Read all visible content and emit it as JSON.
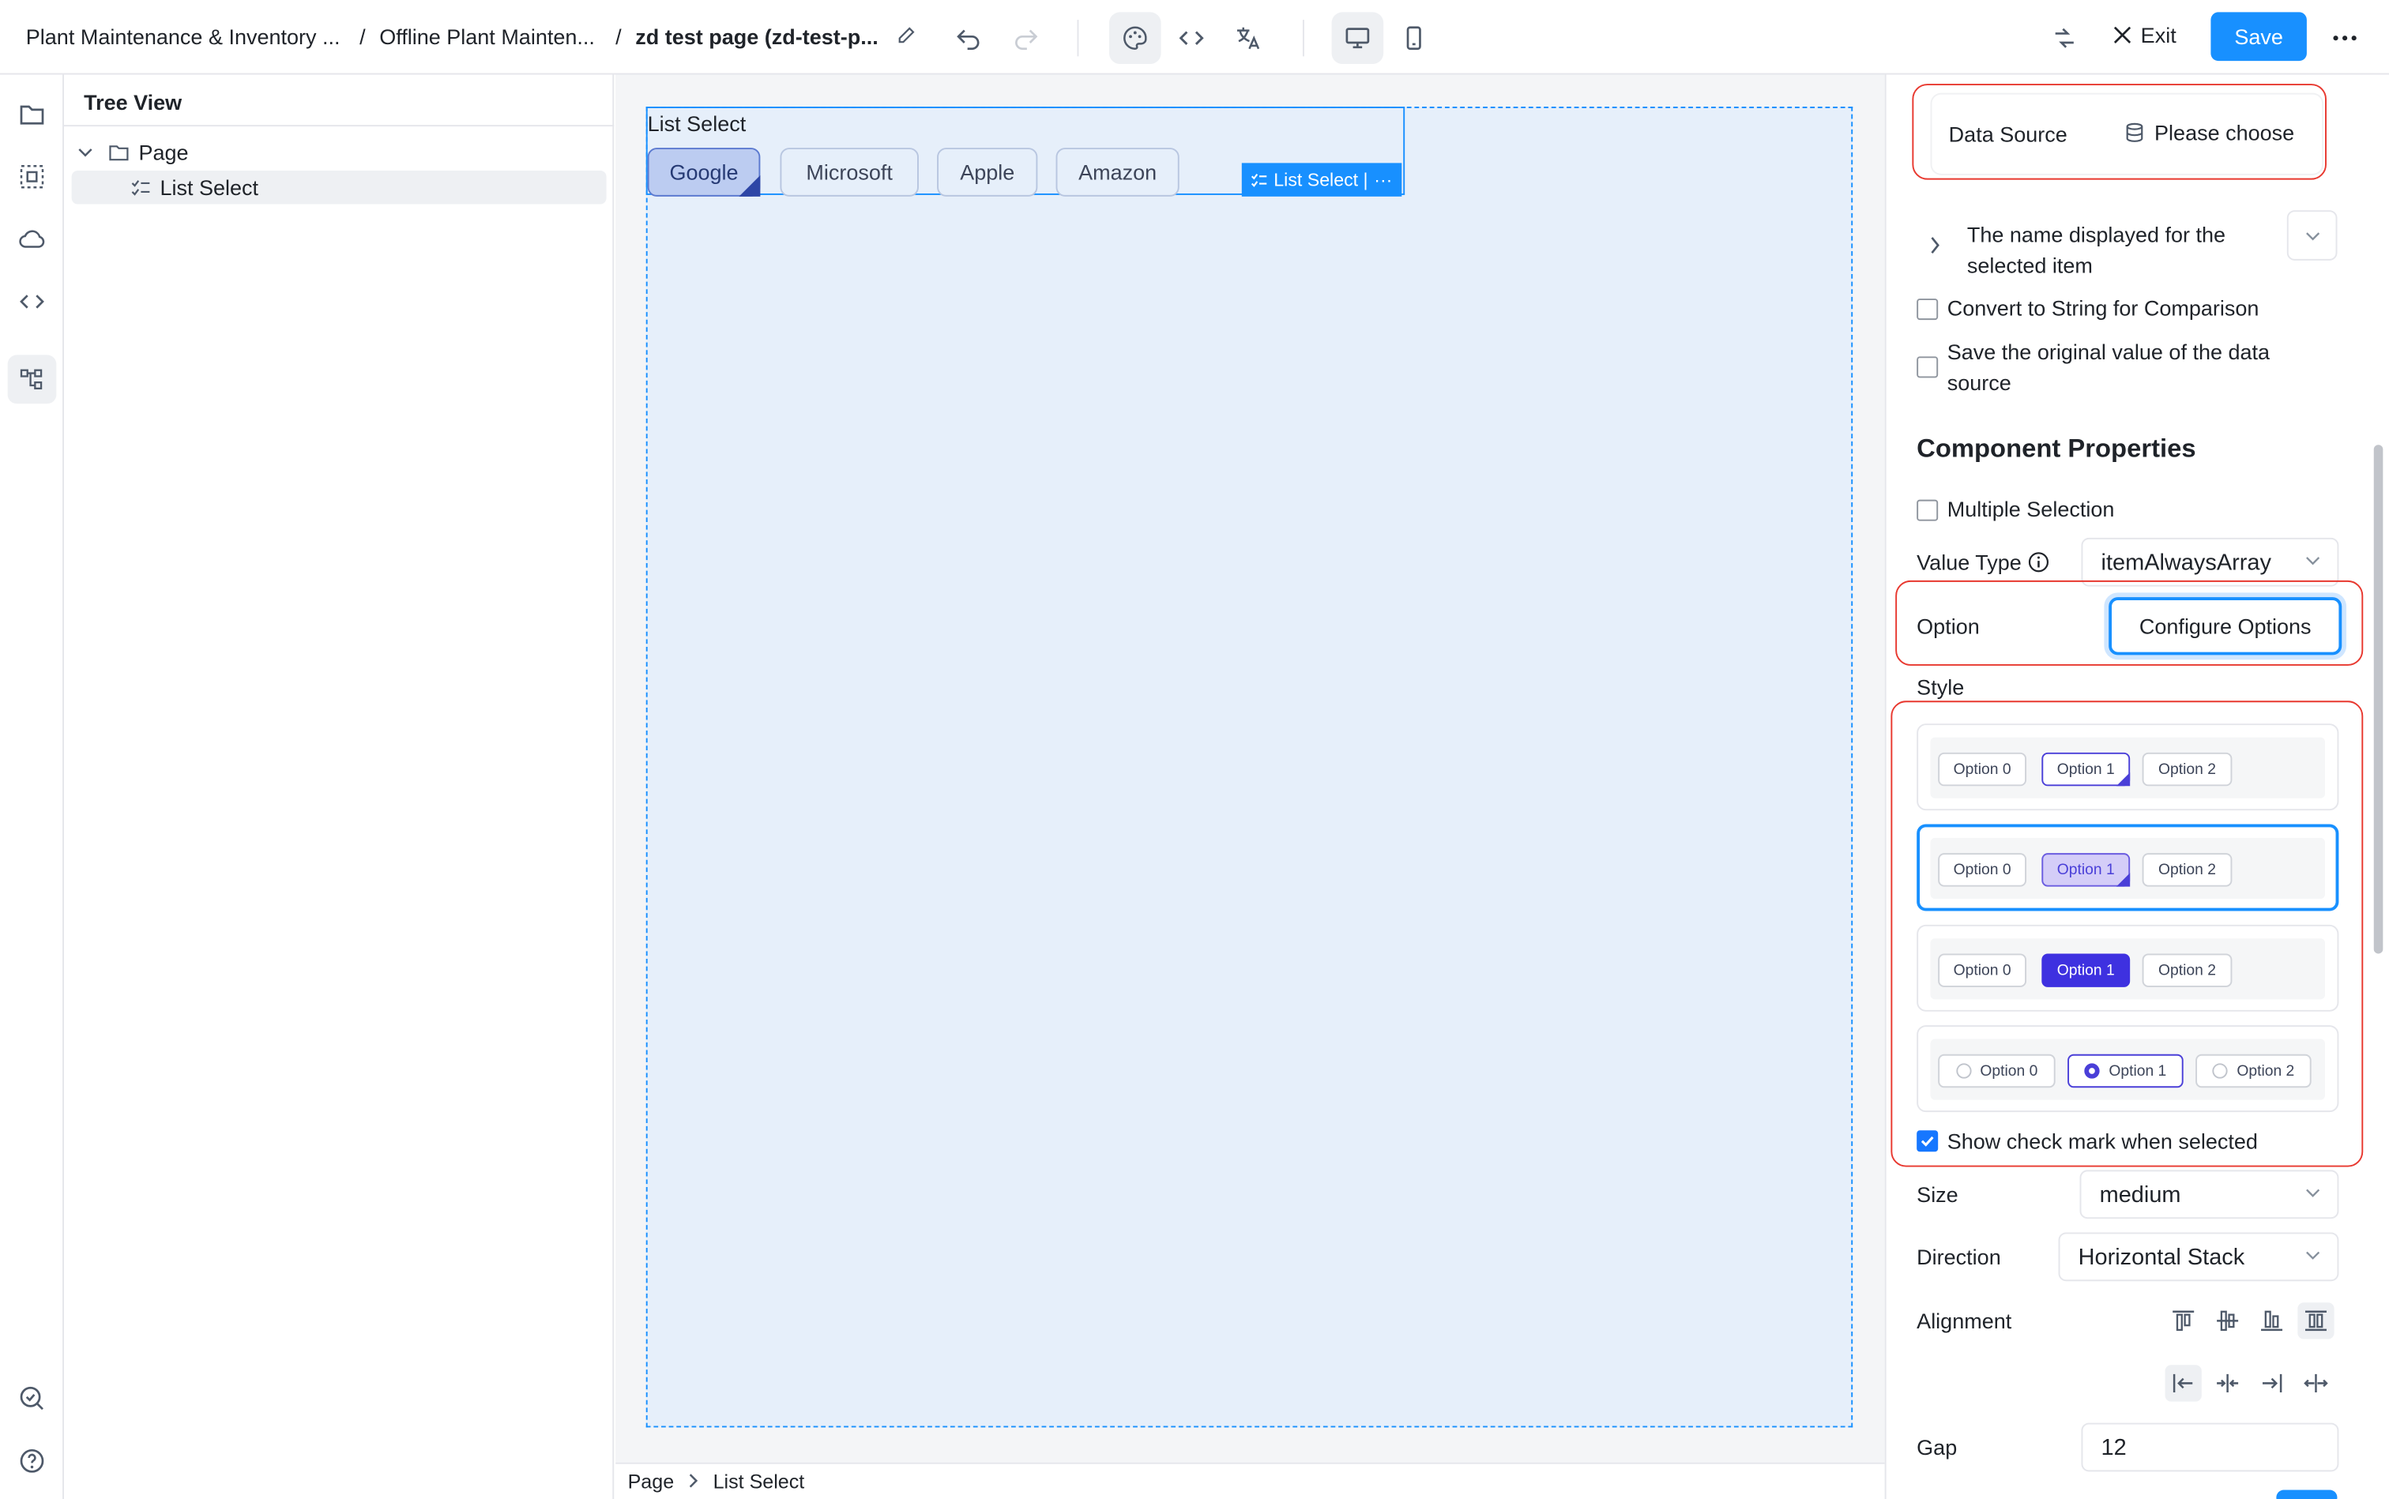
{
  "breadcrumb": {
    "app": "Plant Maintenance & Inventory ...",
    "module": "Offline Plant Mainten...",
    "page": "zd test page (zd-test-p..."
  },
  "toolbar": {
    "exit_label": "Exit",
    "save_label": "Save"
  },
  "tree": {
    "title": "Tree View",
    "nodes": [
      {
        "label": "Page"
      },
      {
        "label": "List Select"
      }
    ]
  },
  "canvas": {
    "component_label": "List Select",
    "options": [
      "Google",
      "Microsoft",
      "Apple",
      "Amazon"
    ],
    "selected": "Google",
    "tag_label": "List Select |",
    "tag_more": "···"
  },
  "statusbar": {
    "path": [
      "Page",
      "List Select"
    ]
  },
  "panel": {
    "data_source_label": "Data Source",
    "data_source_value": "Please choose",
    "display_name_label": "The name displayed for the selected item",
    "convert_string_label": "Convert to String for Comparison",
    "save_original_label": "Save the original value of the data source",
    "component_properties_title": "Component Properties",
    "multiple_selection_label": "Multiple Selection",
    "value_type_label": "Value Type",
    "value_type_value": "itemAlwaysArray",
    "option_label": "Option",
    "configure_options_label": "Configure Options",
    "style_label": "Style",
    "style_options": [
      "Option 0",
      "Option 1",
      "Option 2"
    ],
    "show_check_label": "Show check mark when selected",
    "show_check_checked": true,
    "size_label": "Size",
    "size_value": "medium",
    "direction_label": "Direction",
    "direction_value": "Horizontal Stack",
    "alignment_label": "Alignment",
    "gap_label": "Gap",
    "gap_value": "12"
  },
  "colors": {
    "accent": "#1890ff",
    "highlight": "#e8382f",
    "option_selected": "#3e31e0"
  }
}
